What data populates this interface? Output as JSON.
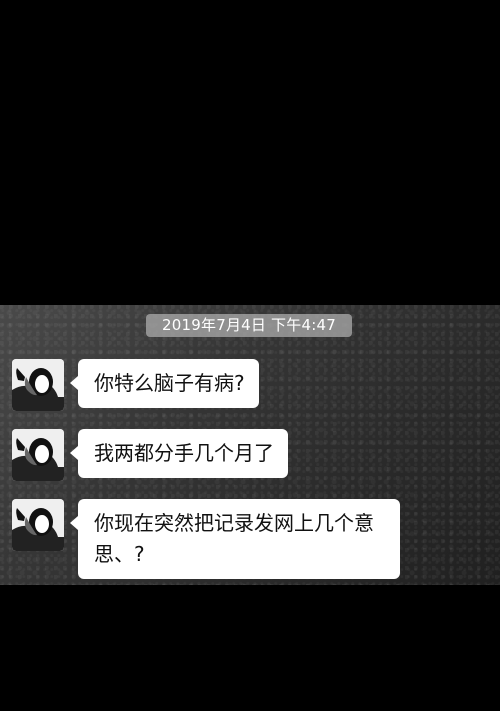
{
  "chat": {
    "timestamp": "2019年7月4日 下午4:47",
    "messages": [
      {
        "text": "你特么脑子有病?"
      },
      {
        "text": "我两都分手几个月了"
      },
      {
        "text": "你现在突然把记录发网上几个意思、?"
      }
    ]
  },
  "colors": {
    "page_background": "#000000",
    "bubble_background": "#ffffff",
    "timestamp_background": "#a5a5a5"
  },
  "icons": {
    "avatar": "avatar"
  }
}
